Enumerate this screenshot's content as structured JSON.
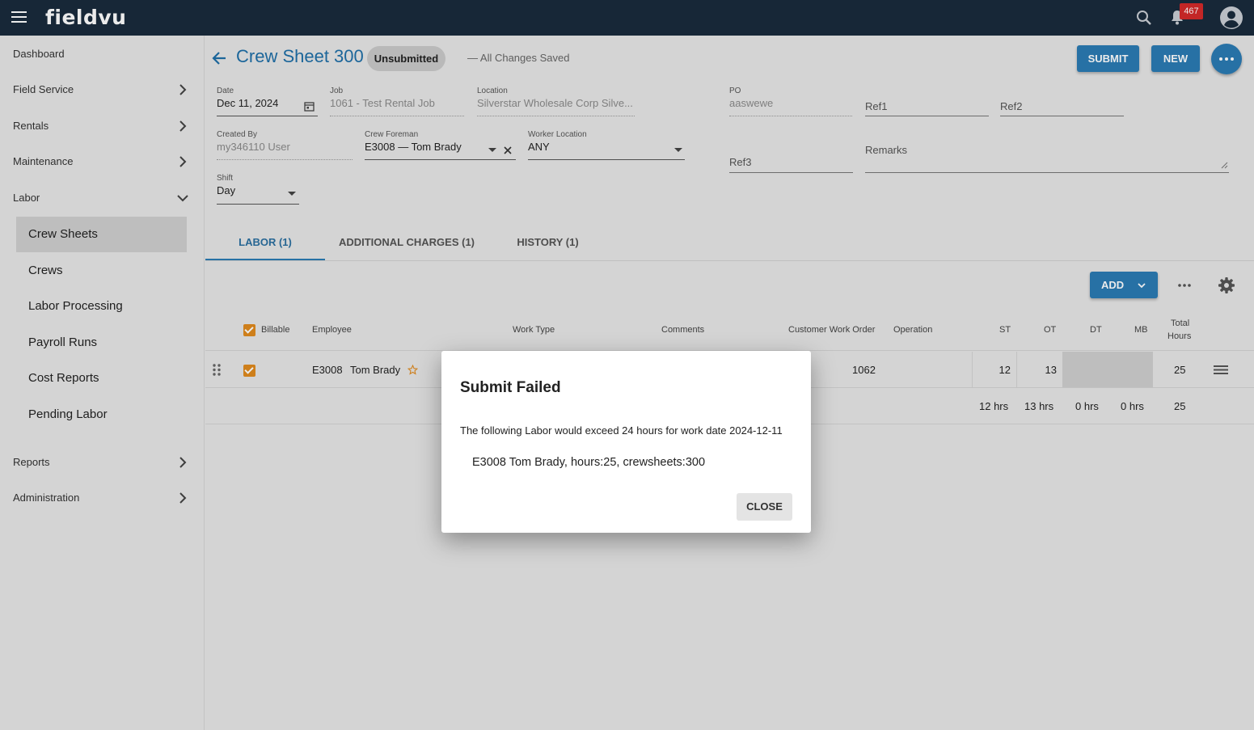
{
  "app": {
    "logo": "fieldvu",
    "notification_count": "467"
  },
  "sidebar": {
    "items": [
      {
        "label": "Dashboard"
      },
      {
        "label": "Field Service"
      },
      {
        "label": "Rentals"
      },
      {
        "label": "Maintenance"
      },
      {
        "label": "Labor"
      },
      {
        "label": "Reports"
      },
      {
        "label": "Administration"
      }
    ],
    "labor_subitems": [
      {
        "label": "Crew Sheets"
      },
      {
        "label": "Crews"
      },
      {
        "label": "Labor Processing"
      },
      {
        "label": "Payroll Runs"
      },
      {
        "label": "Cost Reports"
      },
      {
        "label": "Pending Labor"
      }
    ]
  },
  "header": {
    "title": "Crew Sheet 300",
    "status": "Unsubmitted",
    "saved_text": "— All Changes Saved",
    "submit_label": "SUBMIT",
    "new_label": "NEW"
  },
  "form": {
    "date": {
      "label": "Date",
      "value": "Dec 11, 2024"
    },
    "job": {
      "label": "Job",
      "value": "1061 - Test Rental Job"
    },
    "location": {
      "label": "Location",
      "value": "Silverstar Wholesale Corp Silve..."
    },
    "po": {
      "label": "PO",
      "value": "aaswewe"
    },
    "ref1": {
      "placeholder": "Ref1"
    },
    "ref2": {
      "placeholder": "Ref2"
    },
    "created_by": {
      "label": "Created By",
      "value": "my346110 User"
    },
    "crew_foreman": {
      "label": "Crew Foreman",
      "value": "E3008 — Tom Brady"
    },
    "worker_location": {
      "label": "Worker Location",
      "value": "ANY"
    },
    "ref3": {
      "placeholder": "Ref3"
    },
    "remarks": {
      "placeholder": "Remarks"
    },
    "shift": {
      "label": "Shift",
      "value": "Day"
    }
  },
  "tabs": [
    {
      "label": "LABOR  (1)"
    },
    {
      "label": "ADDITIONAL CHARGES (1)"
    },
    {
      "label": "HISTORY (1)"
    }
  ],
  "toolbar": {
    "add_label": "ADD"
  },
  "table": {
    "headers": {
      "billable": "Billable",
      "employee": "Employee",
      "work_type": "Work Type",
      "comments": "Comments",
      "customer_work_order": "Customer Work Order",
      "operation": "Operation",
      "st": "ST",
      "ot": "OT",
      "dt": "DT",
      "mb": "MB",
      "total_hours_1": "Total",
      "total_hours_2": "Hours"
    },
    "row": {
      "employee_id": "E3008",
      "employee_name": "Tom Brady",
      "customer_work_order": "1062",
      "st": "12",
      "ot": "13",
      "total": "25"
    },
    "totals": {
      "st": "12  hrs",
      "ot": "13  hrs",
      "dt": "0  hrs",
      "mb": "0  hrs",
      "total": "25"
    }
  },
  "dialog": {
    "title": "Submit Failed",
    "message": "The following Labor would exceed 24 hours for work date 2024-12-11",
    "detail": "E3008 Tom Brady, hours:25, crewsheets:300",
    "close_label": "CLOSE"
  },
  "colors": {
    "topbar": "#1a2b3c",
    "accent": "#2b7bb4",
    "checkbox": "#e08a1e",
    "badge": "#d42a2a"
  }
}
